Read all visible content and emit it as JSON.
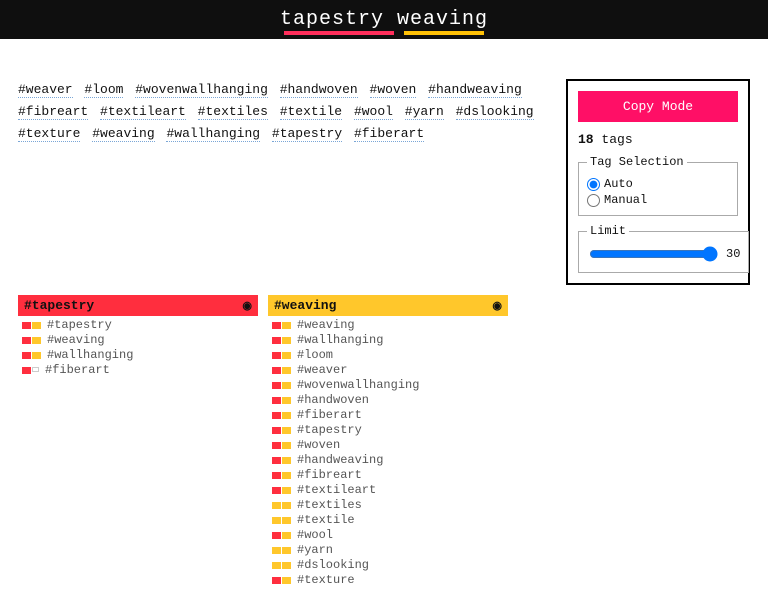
{
  "header": {
    "title": "tapestry weaving"
  },
  "tags": [
    "#weaver",
    "#loom",
    "#wovenwallhanging",
    "#handwoven",
    "#woven",
    "#handweaving",
    "#fibreart",
    "#textileart",
    "#textiles",
    "#textile",
    "#wool",
    "#yarn",
    "#dslooking",
    "#texture",
    "#weaving",
    "#wallhanging",
    "#tapestry",
    "#fiberart"
  ],
  "panel": {
    "copy_label": "Copy Mode",
    "count_number": "18",
    "count_label": "tags",
    "selection_legend": "Tag Selection",
    "auto_label": "Auto",
    "manual_label": "Manual",
    "limit_legend": "Limit",
    "limit_value": "30"
  },
  "columns": [
    {
      "color": "red",
      "title": "#tapestry",
      "items": [
        {
          "chips": [
            "red",
            "yellow"
          ],
          "text": "#tapestry"
        },
        {
          "chips": [
            "red",
            "yellow"
          ],
          "text": "#weaving"
        },
        {
          "chips": [
            "red",
            "yellow"
          ],
          "text": "#wallhanging"
        },
        {
          "chips": [
            "red",
            "empty"
          ],
          "text": "#fiberart"
        }
      ]
    },
    {
      "color": "yellow",
      "title": "#weaving",
      "items": [
        {
          "chips": [
            "red",
            "yellow"
          ],
          "text": "#weaving"
        },
        {
          "chips": [
            "red",
            "yellow"
          ],
          "text": "#wallhanging"
        },
        {
          "chips": [
            "red",
            "yellow"
          ],
          "text": "#loom"
        },
        {
          "chips": [
            "red",
            "yellow"
          ],
          "text": "#weaver"
        },
        {
          "chips": [
            "red",
            "yellow"
          ],
          "text": "#wovenwallhanging"
        },
        {
          "chips": [
            "red",
            "yellow"
          ],
          "text": "#handwoven"
        },
        {
          "chips": [
            "red",
            "yellow"
          ],
          "text": "#fiberart"
        },
        {
          "chips": [
            "red",
            "yellow"
          ],
          "text": "#tapestry"
        },
        {
          "chips": [
            "red",
            "yellow"
          ],
          "text": "#woven"
        },
        {
          "chips": [
            "red",
            "yellow"
          ],
          "text": "#handweaving"
        },
        {
          "chips": [
            "red",
            "yellow"
          ],
          "text": "#fibreart"
        },
        {
          "chips": [
            "red",
            "yellow"
          ],
          "text": "#textileart"
        },
        {
          "chips": [
            "yellow",
            "yellow"
          ],
          "text": "#textiles"
        },
        {
          "chips": [
            "yellow",
            "yellow"
          ],
          "text": "#textile"
        },
        {
          "chips": [
            "red",
            "yellow"
          ],
          "text": "#wool"
        },
        {
          "chips": [
            "yellow",
            "yellow"
          ],
          "text": "#yarn"
        },
        {
          "chips": [
            "yellow",
            "yellow"
          ],
          "text": "#dslooking"
        },
        {
          "chips": [
            "red",
            "yellow"
          ],
          "text": "#texture"
        }
      ]
    }
  ]
}
